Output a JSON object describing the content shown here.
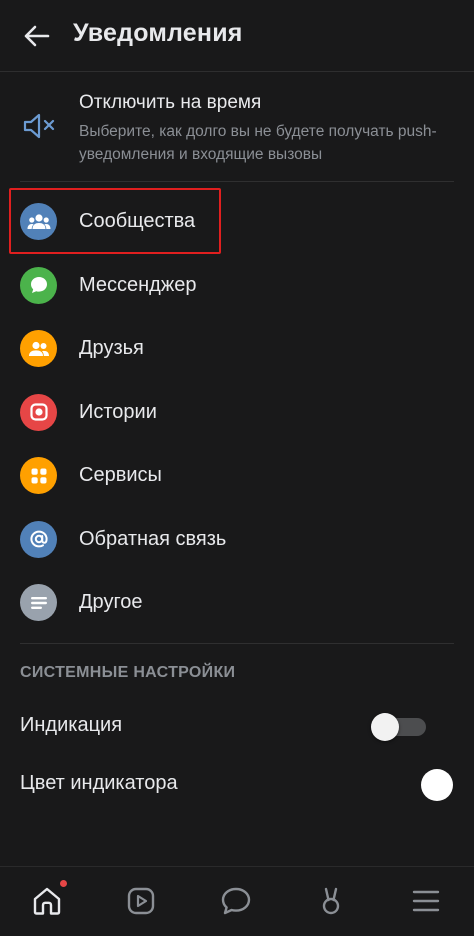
{
  "header": {
    "title": "Уведомления"
  },
  "mute": {
    "title": "Отключить на время",
    "description": "Выберите, как долго вы не будете получать push-уведомления и входящие вызовы"
  },
  "categories": [
    {
      "label": "Сообщества",
      "icon": "community-icon",
      "color": "#5181b8"
    },
    {
      "label": "Мессенджер",
      "icon": "messenger-icon",
      "color": "#4bb34b"
    },
    {
      "label": "Друзья",
      "icon": "friends-icon",
      "color": "#ffa000"
    },
    {
      "label": "Истории",
      "icon": "stories-icon",
      "color": "#e64646"
    },
    {
      "label": "Сервисы",
      "icon": "services-icon",
      "color": "#ffa000"
    },
    {
      "label": "Обратная связь",
      "icon": "feedback-icon",
      "color": "#5181b8"
    },
    {
      "label": "Другое",
      "icon": "other-icon",
      "color": "#99a2ad"
    }
  ],
  "system": {
    "section_title": "СИСТЕМНЫЕ НАСТРОЙКИ",
    "indication_label": "Индикация",
    "indication_enabled": false,
    "color_label": "Цвет индикатора",
    "indicator_color": "#ffffff"
  },
  "tabbar": {
    "tabs": [
      "home-icon",
      "video-icon",
      "messages-icon",
      "services-icon",
      "menu-icon"
    ],
    "active": "home-icon",
    "home_has_notification": true
  }
}
